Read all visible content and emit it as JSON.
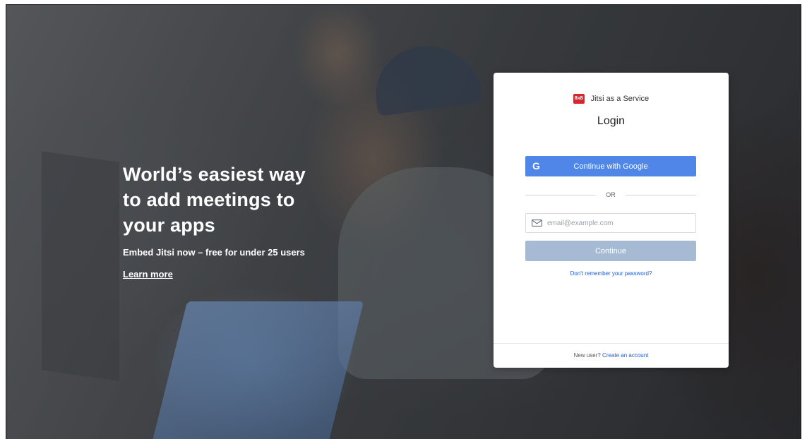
{
  "hero": {
    "title_line1": "World’s easiest way",
    "title_line2": "to add meetings to",
    "title_line3": "your apps",
    "subtitle": "Embed Jitsi now – free for under 25 users",
    "link": "Learn more"
  },
  "login": {
    "brand_logo": "8x8",
    "brand_name": "Jitsi as a Service",
    "title": "Login",
    "google_icon": "G",
    "google_button": "Continue with Google",
    "divider": "OR",
    "email_placeholder": "email@example.com",
    "continue_button": "Continue",
    "forgot_password": "Don't remember your password?",
    "footer_text": "New user?",
    "footer_link": "Create an account"
  },
  "icons": {
    "google": "google-icon",
    "mail": "mail-icon",
    "logo": "8x8-logo"
  },
  "colors": {
    "brand_red": "#d8262f",
    "google_blue": "#4f86e7",
    "continue_disabled": "#a6bbd3",
    "link_blue": "#1e5bd6"
  }
}
